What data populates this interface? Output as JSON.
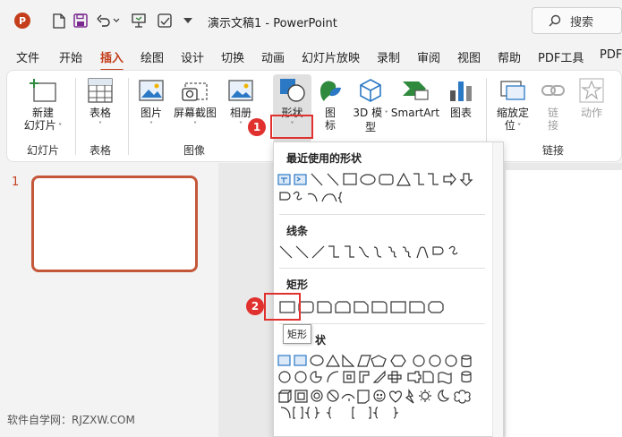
{
  "window": {
    "title": "演示文稿1 - PowerPoint",
    "app_logo": "P",
    "search_label": "搜索"
  },
  "tabs": [
    "文件",
    "开始",
    "插入",
    "绘图",
    "设计",
    "切换",
    "动画",
    "幻灯片放映",
    "录制",
    "审阅",
    "视图",
    "帮助",
    "PDF工具",
    "PDF"
  ],
  "active_tab": "插入",
  "ribbon": {
    "new_slide": [
      "新建",
      "幻灯片"
    ],
    "table": "表格",
    "picture": "图片",
    "screenshot": "屏幕截图",
    "album": "相册",
    "shapes": "形状",
    "icons": [
      "图",
      "标"
    ],
    "model3d": [
      "3D 模",
      "型"
    ],
    "smartart": "SmartArt",
    "chart": "图表",
    "zoom": [
      "缩放定",
      "位"
    ],
    "link": [
      "链",
      "接"
    ],
    "action": "动作",
    "groups": {
      "slides": "幻灯片",
      "tables": "表格",
      "images": "图像",
      "links": "链接"
    }
  },
  "badges": [
    "1",
    "2"
  ],
  "slide_panel": {
    "slide_number": "1"
  },
  "gallery": {
    "recent": "最近使用的形状",
    "lines": "线条",
    "rect": "矩形",
    "basic_suffix": "状"
  },
  "tooltip": "矩形",
  "watermark": "软件自学网：RJZXW.COM",
  "colors": {
    "accent": "#c43e1c",
    "highlight": "#e0312f",
    "slide_thumb": "#c4573a"
  }
}
